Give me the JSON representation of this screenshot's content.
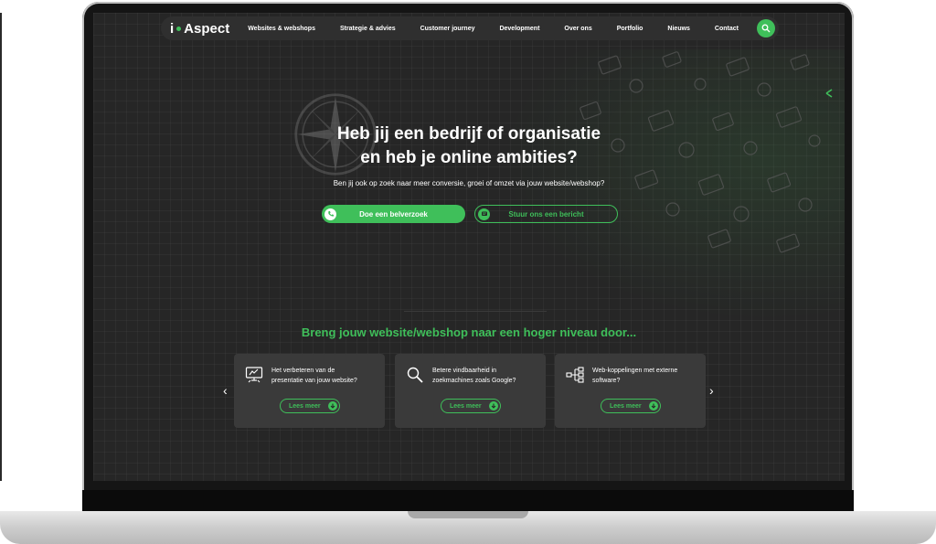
{
  "nav": {
    "logo_letter": "i",
    "logo_text": "Aspect",
    "items": [
      {
        "label": "Websites & webshops"
      },
      {
        "label": "Strategie & advies"
      },
      {
        "label": "Customer journey"
      },
      {
        "label": "Development"
      },
      {
        "label": "Over ons"
      },
      {
        "label": "Portfolio"
      },
      {
        "label": "Nieuws"
      },
      {
        "label": "Contact"
      }
    ],
    "search_icon": "search-icon"
  },
  "hero": {
    "title_line1": "Heb jij een bedrijf of organisatie",
    "title_line2": "en heb je online ambities?",
    "subtitle": "Ben jij ook op zoek naar meer conversie, groei of omzet via jouw website/webshop?",
    "call_button": "Doe een belverzoek",
    "call_icon": "phone-icon",
    "message_button": "Stuur ons een bericht",
    "message_icon": "message-icon"
  },
  "section": {
    "title": "Breng jouw website/webshop naar een hoger niveau door...",
    "cards": [
      {
        "text_line1": "Het verbeteren van de",
        "text_line2": "presentatie van jouw website?",
        "button": "Lees meer",
        "icon": "monitor-icon"
      },
      {
        "text_line1": "Betere vindbaarheid in",
        "text_line2": "zoekmachines zoals Google?",
        "button": "Lees meer",
        "icon": "magnifier-icon"
      },
      {
        "text_line1": "Web-koppelingen met externe",
        "text_line2": "software?",
        "button": "Lees meer",
        "icon": "network-icon"
      }
    ],
    "prev_arrow": "‹",
    "next_arrow": "›"
  },
  "colors": {
    "accent": "#3fbf5a",
    "background": "#262626",
    "card": "#3a3a3a"
  }
}
